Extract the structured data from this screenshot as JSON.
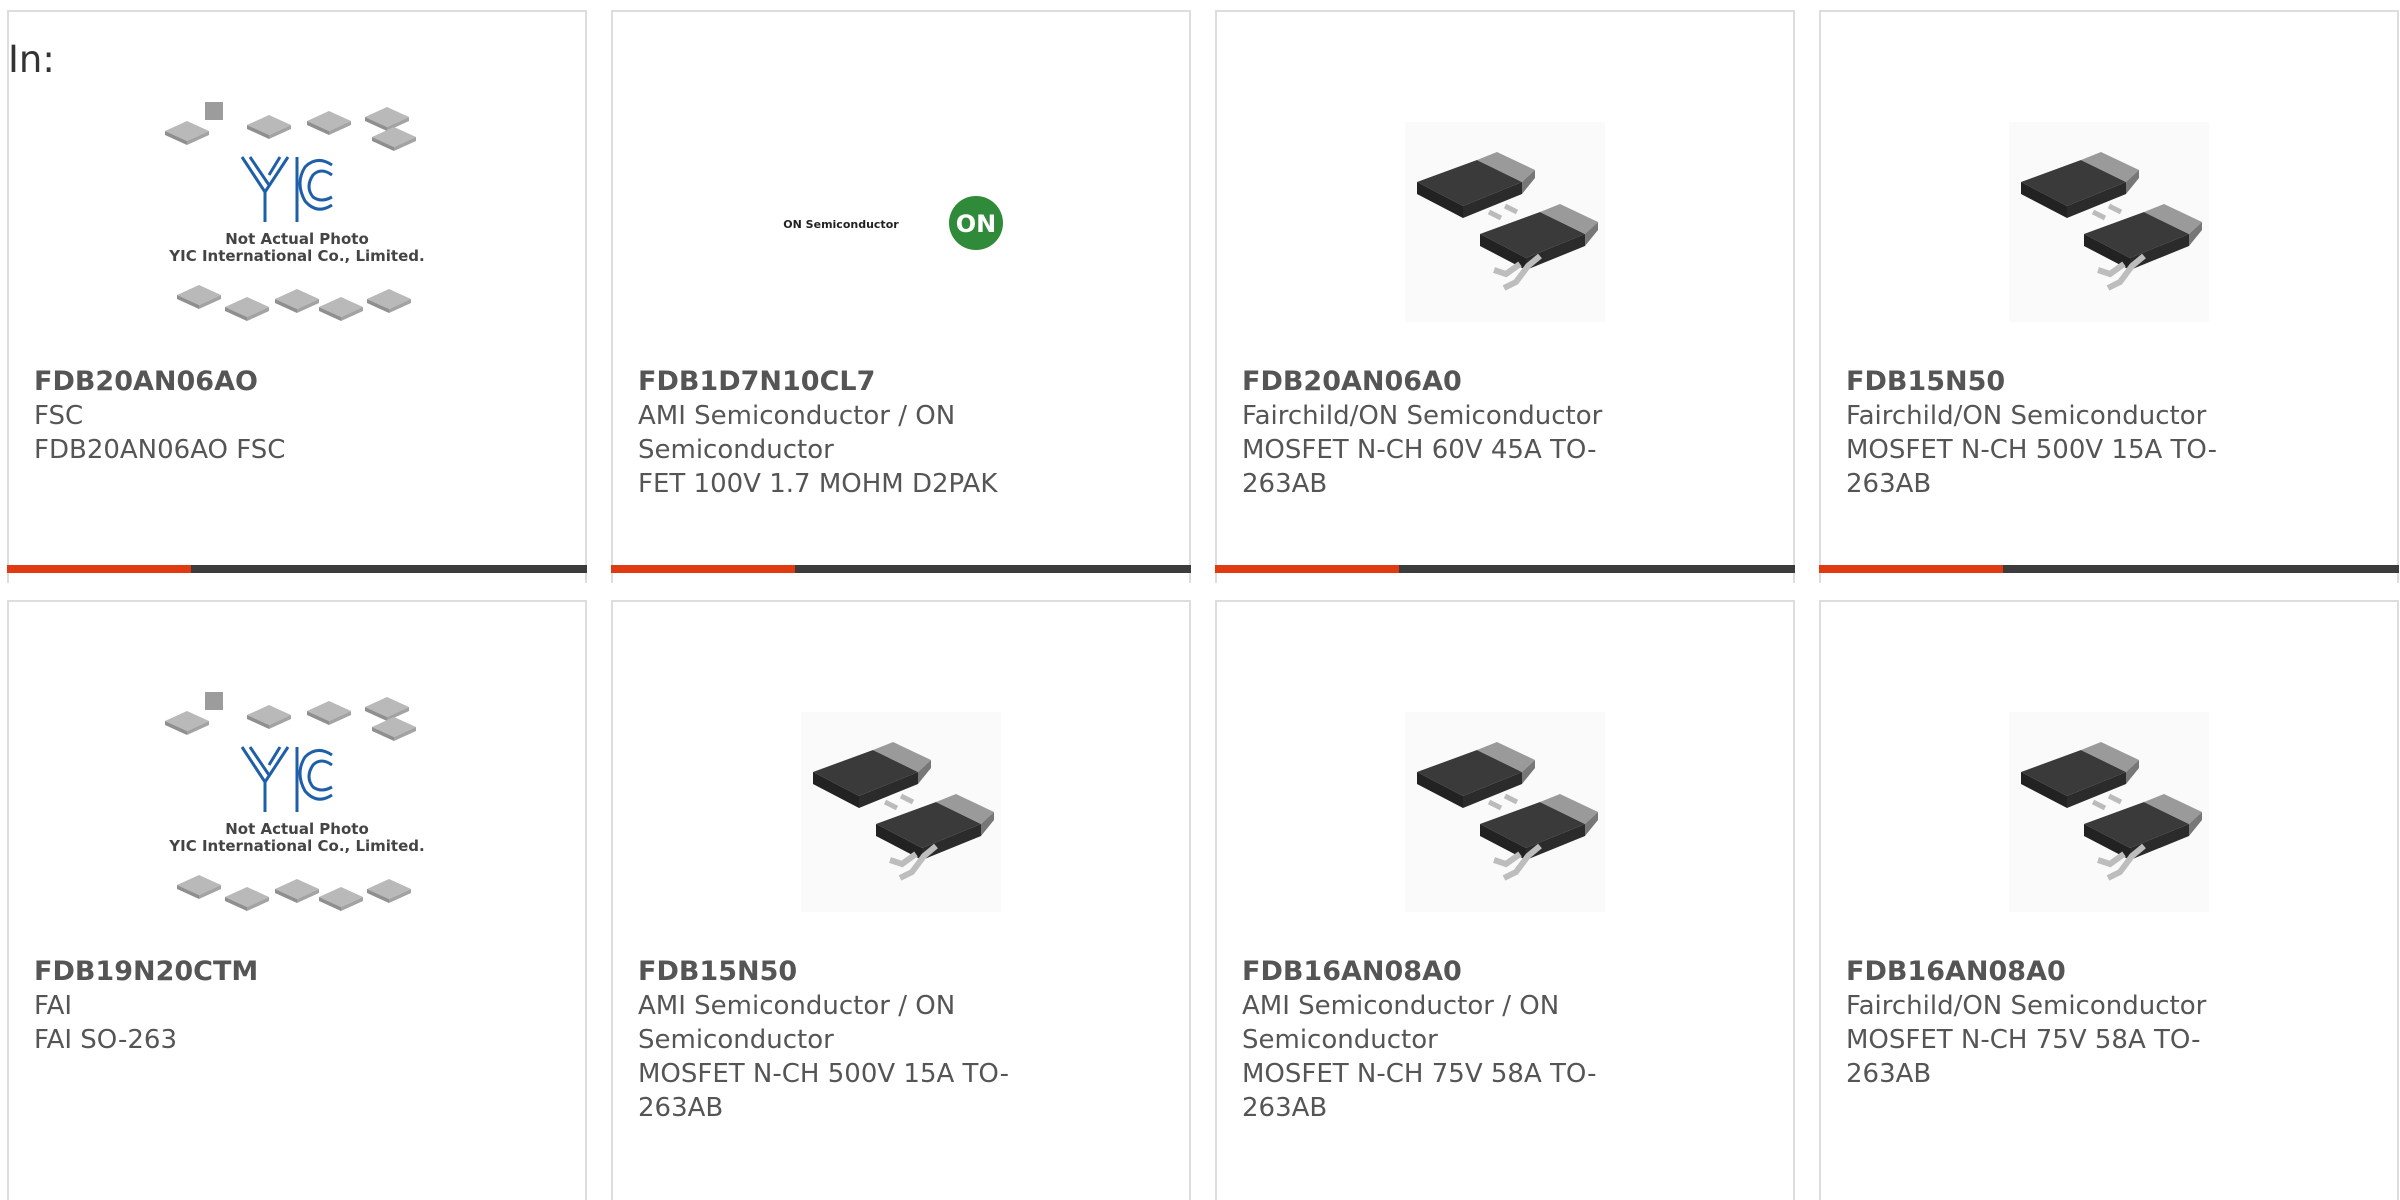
{
  "page": {
    "in_label": "In:"
  },
  "placeholder_text": {
    "line1": "Not Actual Photo",
    "line2": "YIC International Co., Limited."
  },
  "products": [
    {
      "part_number": "FDB20AN06AO",
      "manufacturer": "FSC",
      "description": "FDB20AN06AO FSC",
      "image": "yic-placeholder"
    },
    {
      "part_number": "FDB1D7N10CL7",
      "manufacturer": "AMI Semiconductor / ON Semiconductor",
      "description": "FET 100V 1.7 MOHM D2PAK",
      "image": "on-semiconductor-logo",
      "logo_text": "ON Semiconductor",
      "logo_badge": "ON"
    },
    {
      "part_number": "FDB20AN06A0",
      "manufacturer": "Fairchild/ON Semiconductor",
      "description": "MOSFET N-CH 60V 45A TO-263AB",
      "image": "to263-package"
    },
    {
      "part_number": "FDB15N50",
      "manufacturer": "Fairchild/ON Semiconductor",
      "description": "MOSFET N-CH 500V 15A TO-263AB",
      "image": "to263-package"
    },
    {
      "part_number": "FDB19N20CTM",
      "manufacturer": "FAI",
      "description": "FAI SO-263",
      "image": "yic-placeholder"
    },
    {
      "part_number": "FDB15N50",
      "manufacturer": "AMI Semiconductor / ON Semiconductor",
      "description": "MOSFET N-CH 500V 15A TO-263AB",
      "image": "to263-package"
    },
    {
      "part_number": "FDB16AN08A0",
      "manufacturer": "AMI Semiconductor / ON Semiconductor",
      "description": "MOSFET N-CH 75V 58A TO-263AB",
      "image": "to263-package"
    },
    {
      "part_number": "FDB16AN08A0",
      "manufacturer": "Fairchild/ON Semiconductor",
      "description": "MOSFET N-CH 75V 58A TO-263AB",
      "image": "to263-package"
    }
  ],
  "colors": {
    "accent": "#e03a12",
    "bar": "#3c3c3c",
    "yic_logo": "#1e5fa8",
    "on_badge": "#2f8a3a"
  }
}
